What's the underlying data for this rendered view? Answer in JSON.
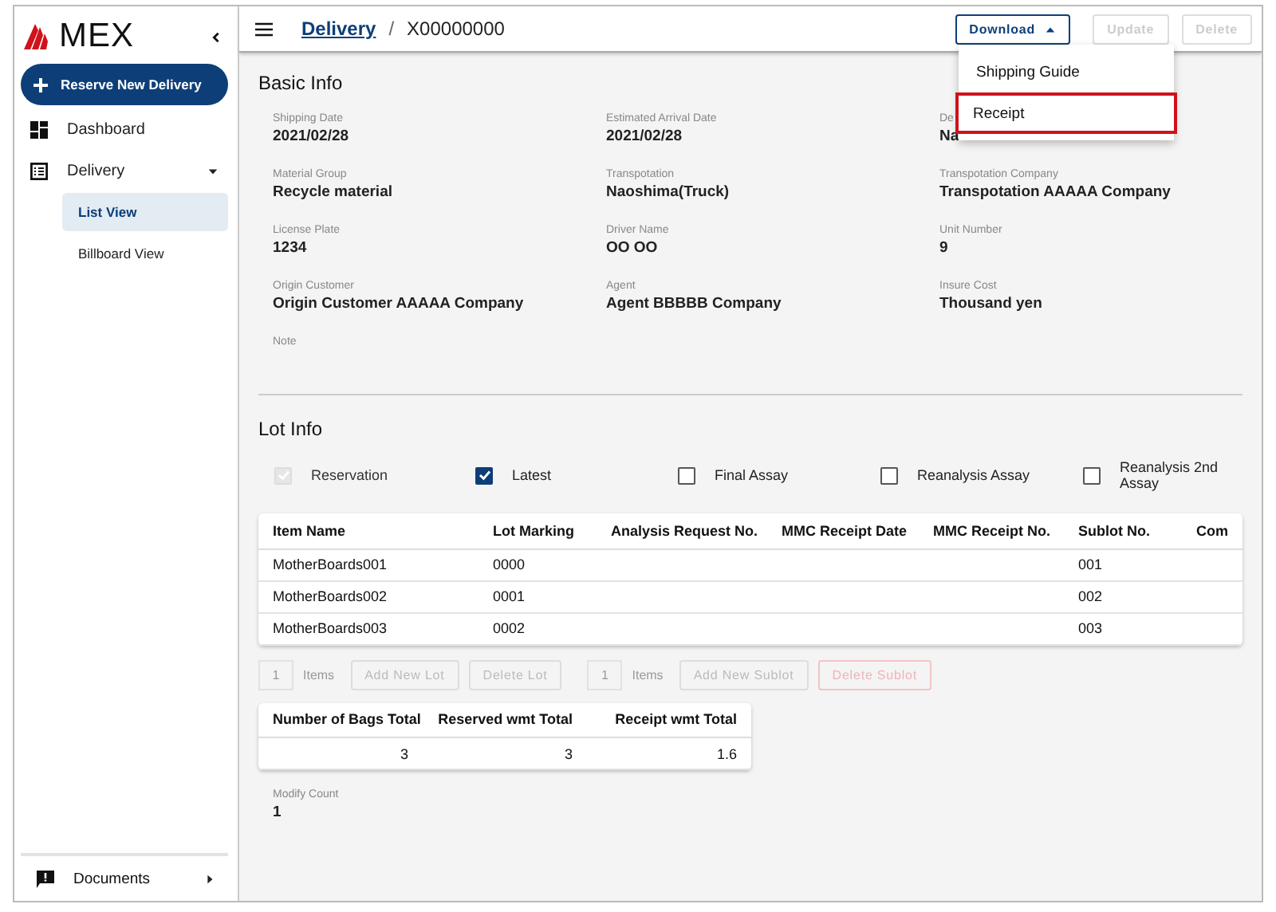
{
  "sidebar": {
    "logo": "MEX",
    "new_button": "Reserve New Delivery",
    "nav": [
      {
        "label": "Dashboard",
        "selected": false
      },
      {
        "label": "Delivery",
        "expanded": true,
        "children": [
          {
            "label": "List View",
            "selected": true
          },
          {
            "label": "Billboard View",
            "selected": false
          }
        ]
      }
    ],
    "footer_item": "Documents"
  },
  "header": {
    "breadcrumb_link": "Delivery",
    "separator": "/",
    "current": "X00000000",
    "buttons": [
      {
        "label": "Download",
        "kind": "dropdown",
        "open": true,
        "disabled": false
      },
      {
        "label": "Update",
        "kind": "plain",
        "disabled": true
      },
      {
        "label": "Delete",
        "kind": "plain",
        "disabled": true
      }
    ],
    "menu": [
      {
        "label": "Shipping Guide",
        "highlighted": false
      },
      {
        "label": "Receipt",
        "highlighted": true
      }
    ]
  },
  "basic_info": {
    "title": "Basic Info",
    "fields": [
      {
        "label": "Shipping Date",
        "value": "2021/02/28"
      },
      {
        "label": "Estimated Arrival Date",
        "value": "2021/02/28"
      },
      {
        "label": "De",
        "value": "Na"
      },
      {
        "label": "Material Group",
        "value": "Recycle material"
      },
      {
        "label": "Transpotation",
        "value": "Naoshima(Truck)"
      },
      {
        "label": "Transpotation Company",
        "value": "Transpotation AAAAA Company"
      },
      {
        "label": "License Plate",
        "value": "1234"
      },
      {
        "label": "Driver Name",
        "value": "OO OO"
      },
      {
        "label": "Unit Number",
        "value": "9"
      },
      {
        "label": "Origin Customer",
        "value": "Origin Customer AAAAA Company"
      },
      {
        "label": "Agent",
        "value": "Agent BBBBB Company"
      },
      {
        "label": "Insure Cost",
        "value": "Thousand yen"
      },
      {
        "label": "Note"
      }
    ]
  },
  "lot_info": {
    "title": "Lot Info",
    "checkboxes": [
      {
        "label": "Reservation",
        "checked": true,
        "disabled": true
      },
      {
        "label": "Latest",
        "checked": true,
        "disabled": false
      },
      {
        "label": "Final Assay",
        "checked": false,
        "disabled": false
      },
      {
        "label": "Reanalysis Assay",
        "checked": false,
        "disabled": false
      },
      {
        "label": "Reanalysis 2nd Assay",
        "checked": false,
        "disabled": false
      }
    ],
    "table": {
      "columns": [
        "Item Name",
        "Lot Marking",
        "Analysis Request No.",
        "MMC Receipt Date",
        "MMC Receipt No.",
        "Sublot No.",
        "Com"
      ],
      "rows": [
        [
          "MotherBoards001",
          "0000",
          "",
          "",
          "",
          "001",
          ""
        ],
        [
          "MotherBoards002",
          "0001",
          "",
          "",
          "",
          "002",
          ""
        ],
        [
          "MotherBoards003",
          "0002",
          "",
          "",
          "",
          "003",
          ""
        ]
      ]
    },
    "toolbar": [
      {
        "kind": "count",
        "value": "1",
        "unit": "Items",
        "disabled": true
      },
      {
        "kind": "button",
        "label": "Add New Lot",
        "disabled": true
      },
      {
        "kind": "button",
        "label": "Delete Lot",
        "disabled": true
      },
      {
        "kind": "count",
        "value": "1",
        "unit": "Items",
        "disabled": true
      },
      {
        "kind": "button",
        "label": "Add New Sublot",
        "disabled": true
      },
      {
        "kind": "danger",
        "label": "Delete Sublot",
        "disabled": true
      }
    ],
    "totals": {
      "columns": [
        "Number of Bags Total",
        "Reserved wmt Total",
        "Receipt wmt Total"
      ],
      "values": [
        "3",
        "3",
        "1.6"
      ]
    },
    "modify": {
      "label": "Modify Count",
      "value": "1"
    }
  }
}
